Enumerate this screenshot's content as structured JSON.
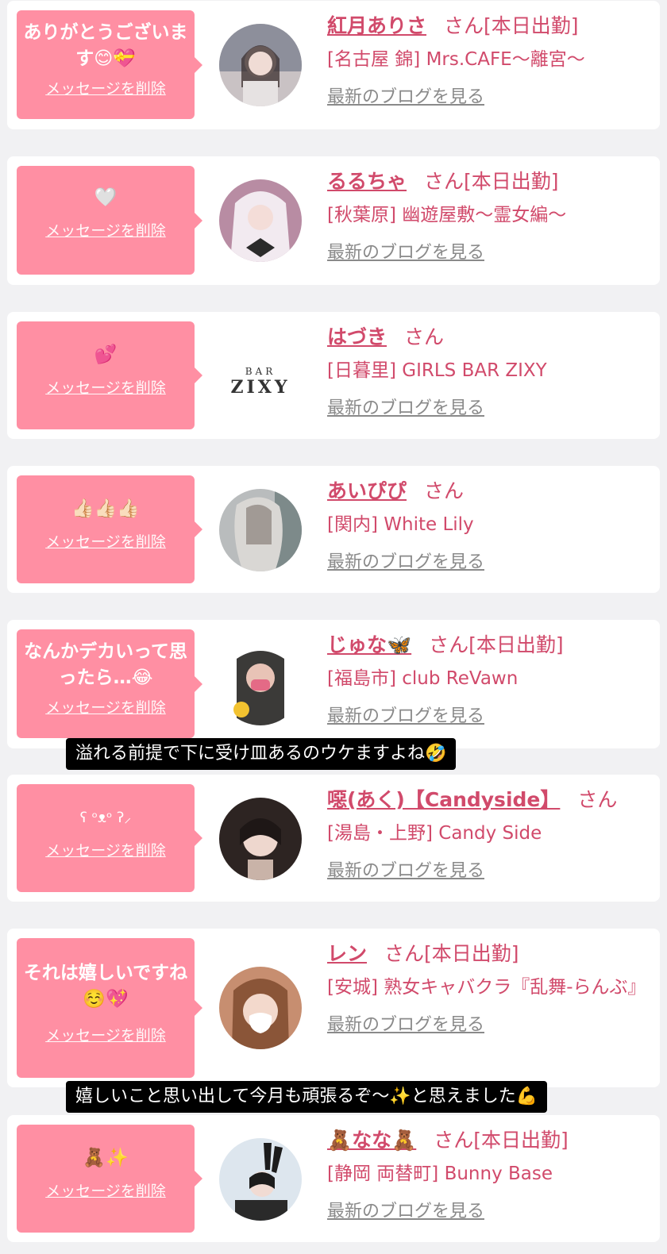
{
  "delete_label": "メッセージを削除",
  "blog_label": "最新のブログを見る",
  "san_label": "さん",
  "colors": {
    "bubble": "#ff8fa3",
    "accent": "#d14a6b",
    "muted": "#8a8a8a",
    "bg": "#f1f1f3"
  },
  "cards": [
    {
      "message": "ありがとうございます😊💝",
      "name": "紅月ありさ",
      "status": "[本日出勤]",
      "shop": "[名古屋 錦] Mrs.CAFE〜離宮〜"
    },
    {
      "message": "🤍",
      "name": "るるちゃ",
      "status": "[本日出勤]",
      "shop": "[秋葉原] 幽遊屋敷〜霊女編〜"
    },
    {
      "message": "💕",
      "name": "はづき",
      "status": "",
      "shop": "[日暮里] GIRLS BAR ZIXY",
      "logo_top": "BAR",
      "logo_bottom": "ZIXY"
    },
    {
      "message": "👍🏻👍🏻👍🏻",
      "name": "あいぴぴ",
      "status": "",
      "shop": "[関内] White Lily"
    },
    {
      "message": "なんかデカいって思ったら…😂",
      "name": "じゅな🦋",
      "status": "[本日出勤]",
      "shop": "[福島市] club ReVawn"
    },
    {
      "message": "ʕ ᵒᴥᵒ ʔ⸝",
      "name": "噁(あく)【Candyside】",
      "status": "",
      "shop": "[湯島・上野] Candy Side"
    },
    {
      "message": "それは嬉しいですね☺️💖",
      "name": "レン",
      "status": "[本日出勤]",
      "shop": "[安城] 熟女キャバクラ『乱舞-らんぶ』"
    },
    {
      "message": "🧸✨",
      "name": "🧸なな🧸",
      "status": "[本日出勤]",
      "shop": "[静岡 両替町] Bunny Base"
    }
  ],
  "captions": [
    "溢れる前提で下に受け皿あるのウケますよね🤣",
    "嬉しいこと思い出して今月も頑張るぞ〜✨と思えました💪"
  ]
}
